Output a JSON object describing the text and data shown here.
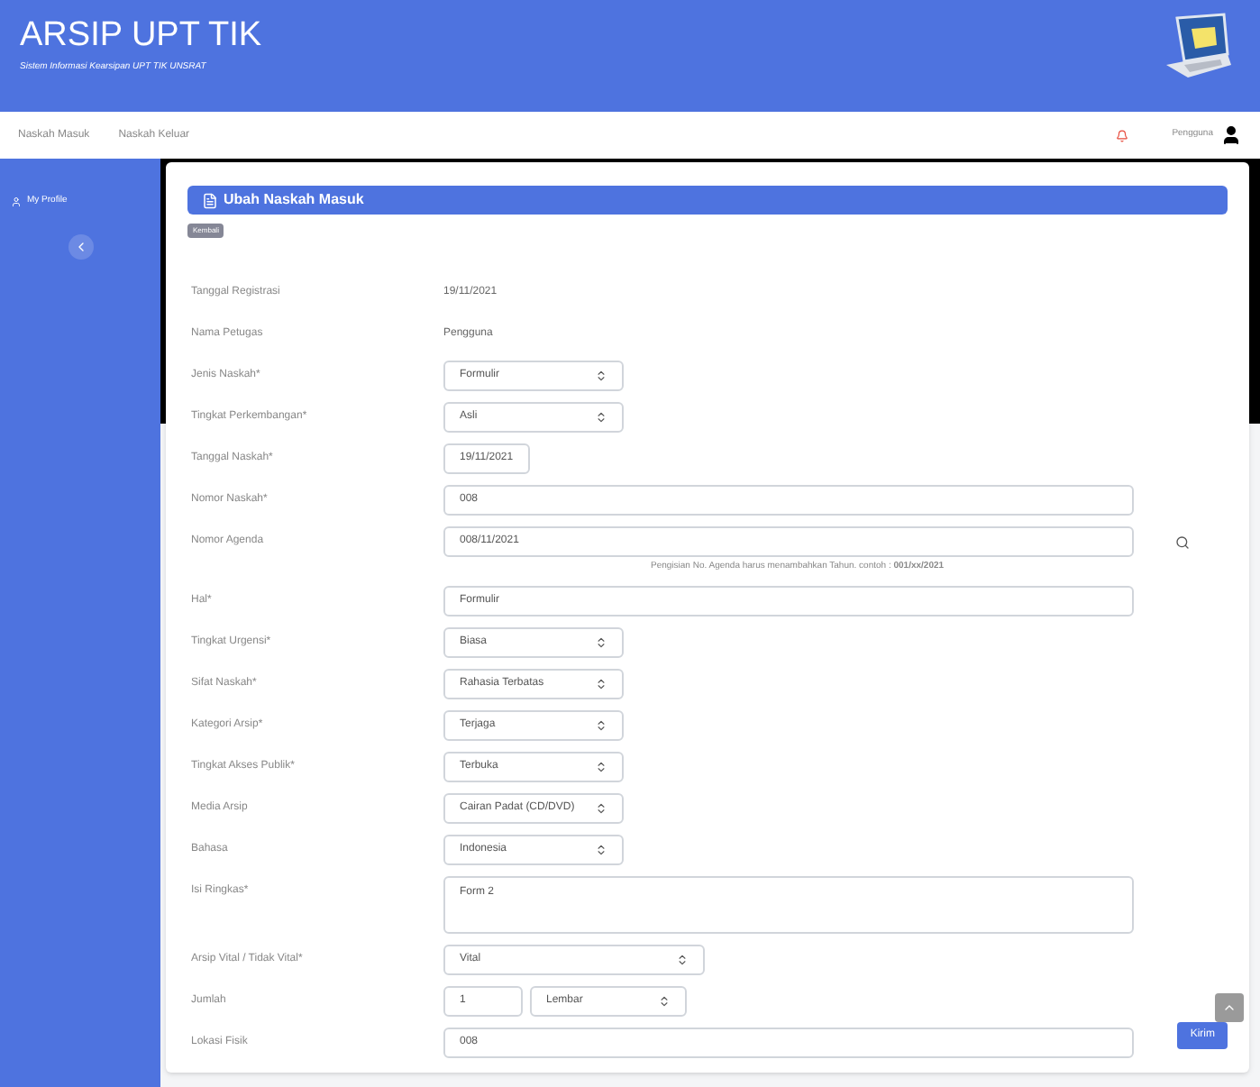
{
  "header": {
    "title": "ARSIP UPT TIK",
    "subtitle": "Sistem Informasi Kearsipan UPT TIK UNSRAT"
  },
  "nav": {
    "items": [
      "Naskah Masuk",
      "Naskah Keluar"
    ],
    "user": "Pengguna"
  },
  "sidebar": {
    "items": [
      {
        "label": "My Profile"
      }
    ]
  },
  "card": {
    "title": "Ubah Naskah Masuk",
    "back": "Kembali",
    "fields": [
      {
        "kind": "text",
        "label": "Tanggal Registrasi",
        "value": "19/11/2021"
      },
      {
        "kind": "text",
        "label": "Nama Petugas",
        "value": "Pengguna"
      },
      {
        "kind": "select",
        "label": "Jenis Naskah*",
        "value": "Formulir"
      },
      {
        "kind": "select",
        "label": "Tingkat Perkembangan*",
        "value": "Asli"
      },
      {
        "kind": "date",
        "label": "Tanggal Naskah*",
        "value": "19/11/2021"
      },
      {
        "kind": "input",
        "label": "Nomor Naskah*",
        "value": "008"
      },
      {
        "kind": "search",
        "label": "Nomor Agenda",
        "value": "008/11/2021",
        "hint": "Pengisian No. Agenda harus menambahkan Tahun. contoh : **001/xx/2021**"
      },
      {
        "kind": "input",
        "label": "Hal*",
        "value": "Formulir"
      },
      {
        "kind": "select",
        "label": "Tingkat Urgensi*",
        "value": "Biasa"
      },
      {
        "kind": "select",
        "label": "Sifat Naskah*",
        "value": "Rahasia Terbatas"
      },
      {
        "kind": "select",
        "label": "Kategori Arsip*",
        "value": "Terjaga"
      },
      {
        "kind": "select",
        "label": "Tingkat Akses Publik*",
        "value": "Terbuka"
      },
      {
        "kind": "select",
        "label": "Media Arsip",
        "value": "Cairan Padat (CD/DVD)"
      },
      {
        "kind": "select",
        "label": "Bahasa",
        "value": "Indonesia"
      },
      {
        "kind": "textarea",
        "label": "Isi Ringkas*",
        "value": "Form 2"
      },
      {
        "kind": "wideselect",
        "label": "Arsip Vital / Tidak Vital*",
        "value": "Vital"
      },
      {
        "kind": "pair",
        "label": "Jumlah",
        "value": "1",
        "unit": "Lembar"
      },
      {
        "kind": "input",
        "label": "Lokasi Fisik",
        "value": "008"
      }
    ],
    "submit": "Kirim"
  }
}
